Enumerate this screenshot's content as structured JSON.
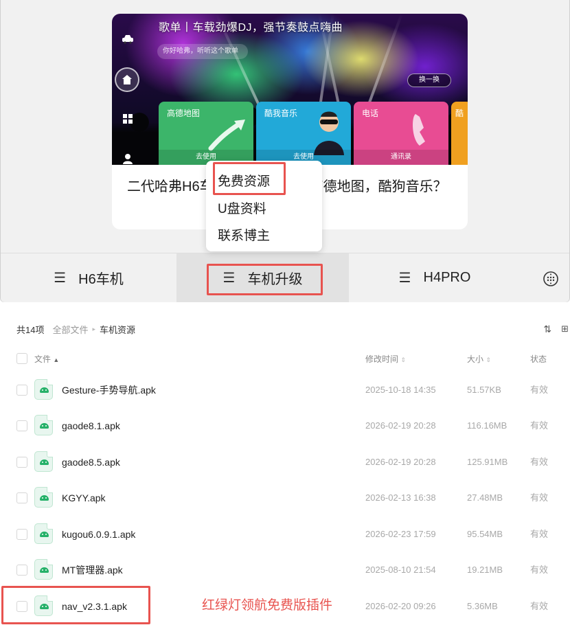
{
  "banner": {
    "title": "歌单丨车载劲爆DJ，强节奏鼓点嗨曲",
    "search_placeholder": "你好哈弗，听听这个歌单",
    "switch_label": "换一换",
    "tiles": [
      {
        "label": "高德地图",
        "footer": "去使用",
        "color": "#3cb56a"
      },
      {
        "label": "酷我音乐",
        "footer": "去使用",
        "color": "#22a9d8"
      },
      {
        "label": "电话",
        "footer": "通讯录",
        "color": "#e84c93"
      },
      {
        "label": "酷",
        "footer": "",
        "color": "#f0a020"
      }
    ]
  },
  "card": {
    "text": "二代哈弗H6车机怎么免费升级高德地图，酷狗音乐？"
  },
  "dropdown": {
    "items": [
      "免费资源",
      "U盘资料",
      "联系博主"
    ]
  },
  "tabs": [
    {
      "label": "H6车机"
    },
    {
      "label": "车机升级"
    },
    {
      "label": "H4PRO"
    }
  ],
  "file_manager": {
    "count": "共14项",
    "breadcrumb": [
      "全部文件",
      "车机资源"
    ],
    "columns": {
      "name": "文件",
      "modified": "修改时间",
      "size": "大小",
      "status": "状态"
    },
    "files": [
      {
        "name": "Gesture-手势导航.apk",
        "modified": "2025-10-18 14:35",
        "size": "51.57KB",
        "status": "有效"
      },
      {
        "name": "gaode8.1.apk",
        "modified": "2026-02-19 20:28",
        "size": "116.16MB",
        "status": "有效"
      },
      {
        "name": "gaode8.5.apk",
        "modified": "2026-02-19 20:28",
        "size": "125.91MB",
        "status": "有效"
      },
      {
        "name": "KGYY.apk",
        "modified": "2026-02-13 16:38",
        "size": "27.48MB",
        "status": "有效"
      },
      {
        "name": "kugou6.0.9.1.apk",
        "modified": "2026-02-23 17:59",
        "size": "95.54MB",
        "status": "有效"
      },
      {
        "name": "MT管理器.apk",
        "modified": "2025-08-10 21:54",
        "size": "19.21MB",
        "status": "有效"
      },
      {
        "name": "nav_v2.3.1.apk",
        "modified": "2026-02-20 09:26",
        "size": "5.36MB",
        "status": "有效"
      }
    ]
  },
  "annotation": "红绿灯领航免费版插件",
  "colors": {
    "highlight": "#e8534f",
    "apk_green": "#25b169",
    "active_tab_bg": "#e2e2e2"
  }
}
